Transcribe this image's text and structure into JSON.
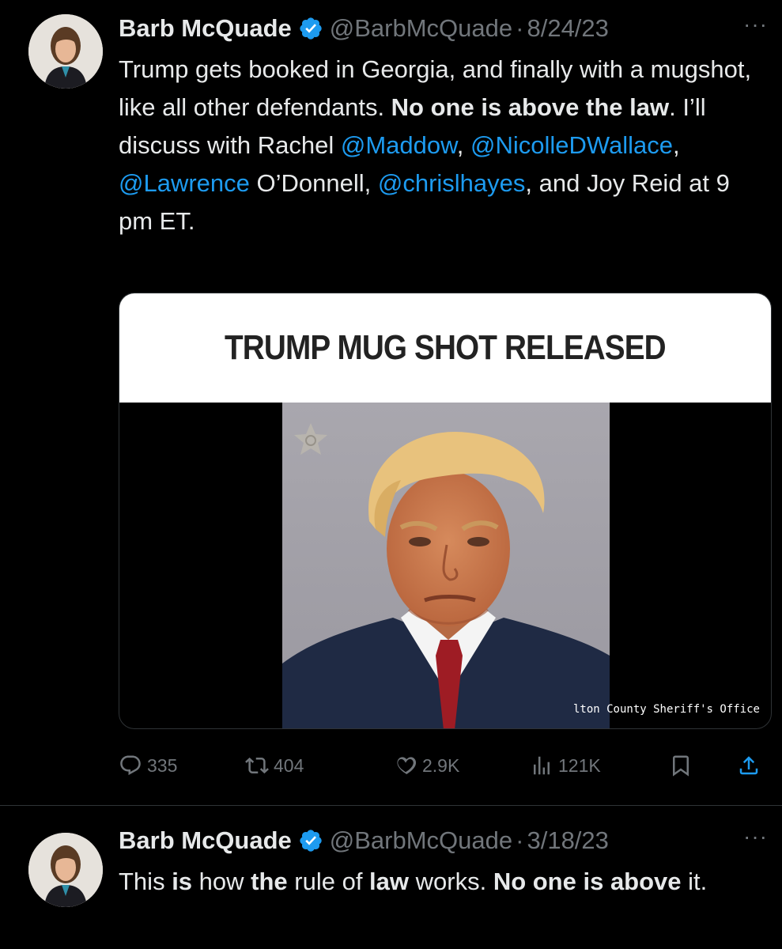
{
  "tweets": [
    {
      "author_name": "Barb McQuade",
      "handle": "@BarbMcQuade",
      "separator": "·",
      "date": "8/24/23",
      "more_label": "···",
      "text_parts": {
        "p1": "Trump gets booked in Georgia, and finally with a mugshot, like all other defendants. ",
        "p2_bold": "No one is above the law",
        "p3": ". I’ll discuss with Rachel ",
        "m1": "@Maddow",
        "p4": ", ",
        "m2": "@NicolleDWallace",
        "p5": ", ",
        "m3": "@Lawrence",
        "p6": " O’Donnell, ",
        "m4": "@chrislhayes",
        "p7": ", and Joy Reid at 9 pm ET."
      },
      "card": {
        "title": "TRUMP MUG SHOT RELEASED",
        "credit": "lton County Sheriff's Office"
      },
      "stats": {
        "replies": "335",
        "reposts": "404",
        "likes": "2.9K",
        "views": "121K"
      }
    },
    {
      "author_name": "Barb McQuade",
      "handle": "@BarbMcQuade",
      "separator": "·",
      "date": "3/18/23",
      "more_label": "···",
      "text_parts": {
        "p1": "This ",
        "b1": "is",
        "p2": " how ",
        "b2": "the",
        "p3": " rule of ",
        "b3": "law",
        "p4": " works. ",
        "b4": "No one is above",
        "p5": " it."
      }
    }
  ],
  "icons": {
    "verified": "verified-badge-icon",
    "reply": "reply-icon",
    "repost": "repost-icon",
    "like": "heart-icon",
    "views": "views-icon",
    "bookmark": "bookmark-icon",
    "share": "share-icon"
  },
  "colors": {
    "background": "#000000",
    "text": "#e7e9ea",
    "secondary": "#71767b",
    "link": "#1d9bf0",
    "verified": "#1d9bf0"
  }
}
